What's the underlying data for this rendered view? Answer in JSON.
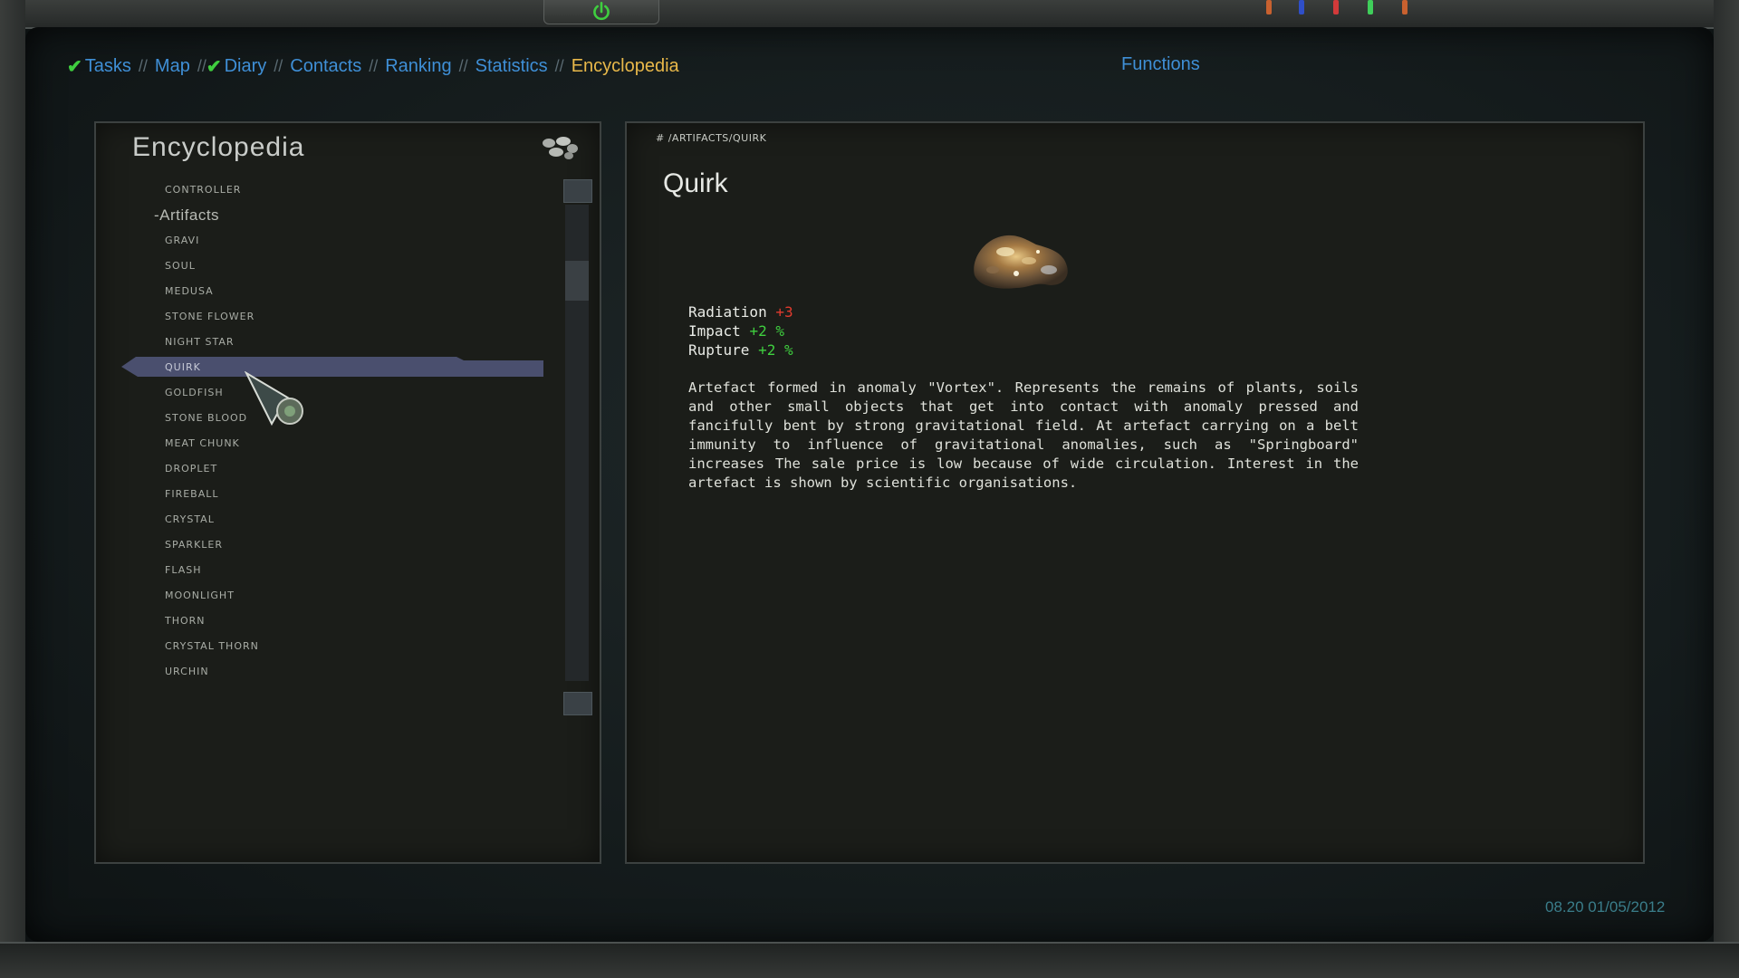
{
  "nav": {
    "items": [
      {
        "label": "Tasks",
        "checked": true,
        "active": false
      },
      {
        "label": "Map",
        "checked": false,
        "active": false
      },
      {
        "label": "Diary",
        "checked": true,
        "active": false
      },
      {
        "label": "Contacts",
        "checked": false,
        "active": false
      },
      {
        "label": "Ranking",
        "checked": false,
        "active": false
      },
      {
        "label": "Statistics",
        "checked": false,
        "active": false
      },
      {
        "label": "Encyclopedia",
        "checked": false,
        "active": true
      }
    ],
    "separator": "//",
    "functions_label": "Functions"
  },
  "encyclopedia": {
    "title": "Encyclopedia",
    "entries": [
      {
        "label": "CONTROLLER",
        "kind": "item"
      },
      {
        "label": "-Artifacts",
        "kind": "category"
      },
      {
        "label": "GRAVI",
        "kind": "item"
      },
      {
        "label": "SOUL",
        "kind": "item"
      },
      {
        "label": "MEDUSA",
        "kind": "item"
      },
      {
        "label": "STONE FLOWER",
        "kind": "item"
      },
      {
        "label": "NIGHT STAR",
        "kind": "item"
      },
      {
        "label": "QUIRK",
        "kind": "item",
        "selected": true
      },
      {
        "label": "GOLDFISH",
        "kind": "item"
      },
      {
        "label": "STONE BLOOD",
        "kind": "item"
      },
      {
        "label": "MEAT CHUNK",
        "kind": "item"
      },
      {
        "label": "DROPLET",
        "kind": "item"
      },
      {
        "label": "FIREBALL",
        "kind": "item"
      },
      {
        "label": "CRYSTAL",
        "kind": "item"
      },
      {
        "label": "SPARKLER",
        "kind": "item"
      },
      {
        "label": "FLASH",
        "kind": "item"
      },
      {
        "label": "MOONLIGHT",
        "kind": "item"
      },
      {
        "label": "THORN",
        "kind": "item"
      },
      {
        "label": "CRYSTAL THORN",
        "kind": "item"
      },
      {
        "label": "URCHIN",
        "kind": "item"
      }
    ]
  },
  "article": {
    "breadcrumb": "# /ARTIFACTS/QUIRK",
    "title": "Quirk",
    "stats": [
      {
        "name": "Radiation",
        "value": "+3",
        "tone": "negative"
      },
      {
        "name": "Impact",
        "value": "+2 %",
        "tone": "positive"
      },
      {
        "name": "Rupture",
        "value": "+2 %",
        "tone": "positive"
      }
    ],
    "description": "Artefact formed in anomaly \"Vortex\". Represents the remains of plants, soils and other small objects that get into contact with anomaly pressed and fancifully bent by strong gravitational field. At artefact carrying on a belt immunity to influence of gravitational anomalies, such as \"Springboard\" increases The sale price is low because of wide circulation. Interest in the artefact is shown by scientific organisations."
  },
  "clock": "08.20 01/05/2012",
  "colors": {
    "nav_link": "#3f8fd6",
    "nav_active": "#e8b84a",
    "check": "#3fce3f",
    "negative": "#e23b2e",
    "positive": "#3fcf3f",
    "selection": "#4a4f6e"
  }
}
